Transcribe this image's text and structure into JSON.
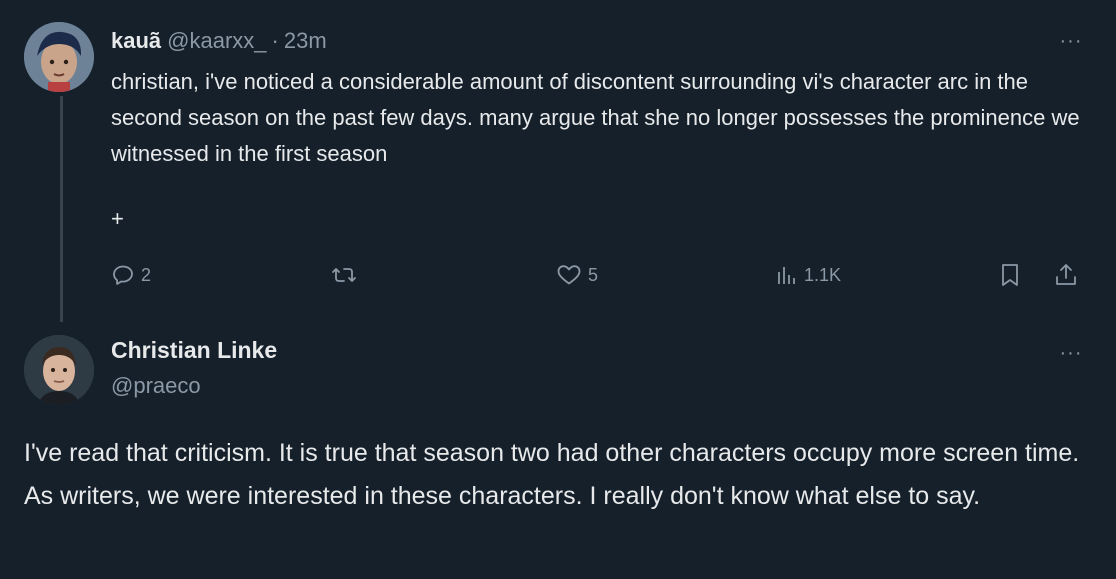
{
  "tweet1": {
    "author_name": "kauã",
    "handle": "@kaarxx_",
    "separator": "·",
    "time": "23m",
    "more": "···",
    "text": "christian, i've noticed a considerable amount of discontent surrounding vi's character arc in the second season on the past few days. many argue that she no longer possesses the prominence we witnessed in the first season",
    "extra": "+",
    "actions": {
      "replies": "2",
      "reposts": "",
      "likes": "5",
      "views": "1.1K"
    }
  },
  "tweet2": {
    "author_name": "Christian Linke",
    "handle": "@praeco",
    "more": "···",
    "text": "I've read that criticism. It is true that season two had other characters occupy more screen time. As writers, we were interested in these characters. I really don't know what else to say."
  },
  "icons": {
    "reply": "reply-icon",
    "repost": "repost-icon",
    "like": "heart-icon",
    "views": "views-icon",
    "bookmark": "bookmark-icon",
    "share": "share-icon"
  },
  "colors": {
    "background": "#15202b",
    "text": "#e7e9ea",
    "muted": "#8b98a5",
    "thread_line": "#38444d"
  }
}
